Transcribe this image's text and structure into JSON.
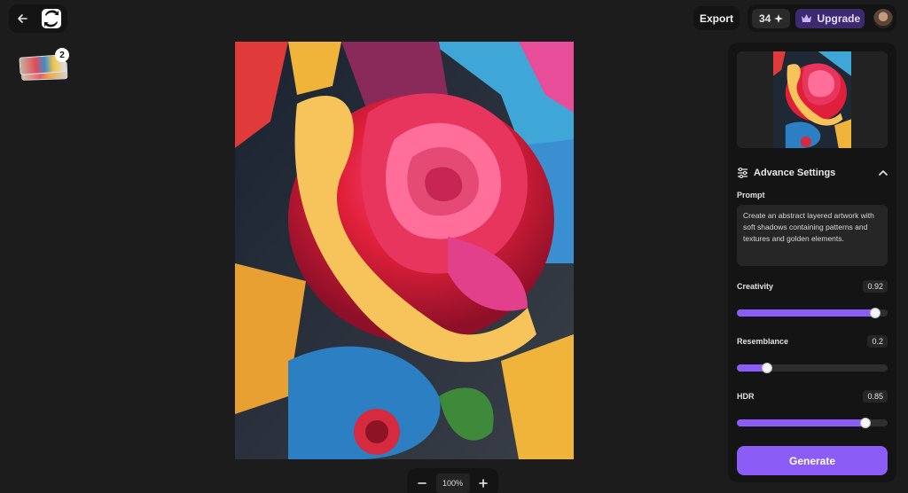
{
  "header": {
    "back_icon": "arrow-left-icon",
    "logo_icon": "app-logo-icon",
    "export_label": "Export",
    "credits": "34",
    "credits_icon": "sparkle-icon",
    "upgrade_label": "Upgrade",
    "upgrade_icon": "crown-icon",
    "avatar_icon": "user-avatar"
  },
  "history": {
    "count": "2"
  },
  "canvas": {
    "image_icon": "rose-artwork-image"
  },
  "zoom": {
    "minus_icon": "minus-icon",
    "level": "100%",
    "plus_icon": "plus-icon"
  },
  "panel": {
    "advance_settings_label": "Advance Settings",
    "advance_settings_icon": "sliders-icon",
    "collapse_icon": "chevron-up-icon",
    "prompt_label": "Prompt",
    "prompt_text": "Create an abstract layered artwork with soft shadows containing patterns and textures and golden elements.",
    "sliders": [
      {
        "label": "Creativity",
        "value": "0.92",
        "fraction": 0.92
      },
      {
        "label": "Resemblance",
        "value": "0.2",
        "fraction": 0.2
      },
      {
        "label": "HDR",
        "value": "0.85",
        "fraction": 0.85
      }
    ],
    "generate_label": "Generate",
    "accent_color": "#8b5cf6"
  }
}
